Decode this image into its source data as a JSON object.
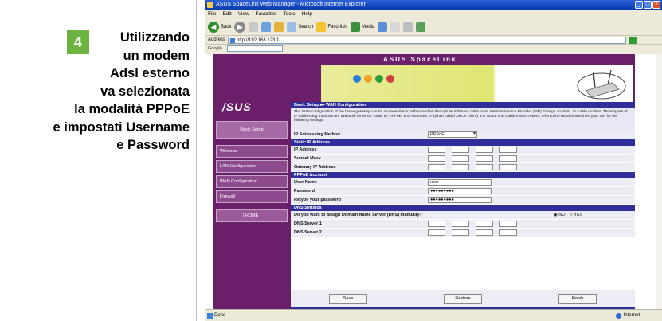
{
  "caption": {
    "step": "4",
    "line1": "Utilizzando",
    "line2": "un modem",
    "line3": "Adsl esterno",
    "line4": "va selezionata",
    "line5": "la modalità PPPoE",
    "line6": "e impostati Username",
    "line7": "e Password",
    "badge_color": "#6db33f"
  },
  "window": {
    "title": "ASUS SpaceLink Web Manager - Microsoft Internet Explorer",
    "menu": [
      "File",
      "Edit",
      "View",
      "Favorites",
      "Tools",
      "Help"
    ],
    "toolbar": {
      "back": "Back",
      "search": "Search",
      "favorites": "Favorites",
      "media": "Media"
    },
    "address_label": "Address",
    "address": "http://192.168.123.1/",
    "google_label": "Google",
    "status": "Done",
    "zone": "Internet"
  },
  "asus": {
    "logo": "/SUS",
    "brand": "ASUS SpaceLink",
    "nav": [
      "Basic Setup",
      "Wireless",
      "LAN Configuration",
      "WAN Configuration",
      "Firewall",
      "[ HOME ]"
    ],
    "section_title": "Basic Setup ▸▸ WAN Configuration",
    "description": "The WAN configuration of the home gateway can be a connection to either modem through an Ethernet cable or an Internet Service Provider (ISP) through an ADSL or Cable modem. Three types of IP addressing methods are available for WAN: Static IP, PPPoE, and Automatic IP (when called DHCP client). For ADSL and Cable modem users, refer to the requirement from your ISP for the following settings.",
    "ip_method_label": "IP Addressing Method",
    "ip_method_value": "PPPoE",
    "static_ip_header": "Static IP Address",
    "ip_address_label": "IP Address",
    "subnet_label": "Subnet Mask",
    "gateway_label": "Gateway IP Address",
    "pppoe_header": "PPPoE Account",
    "username_label": "User Name",
    "username_value": "user",
    "password_label": "Password",
    "password_value": "●●●●●●●●●",
    "retype_label": "Retype your password",
    "retype_value": "●●●●●●●●●",
    "dns_header": "DNS Settings",
    "dns_question": "Do you want to assign Domain Name Server (DNS) manually?",
    "dns_no": "NO",
    "dns_yes": "YES",
    "dns1_label": "DNS Server 1",
    "dns2_label": "DNS Server 2",
    "btn_save": "Save",
    "btn_restore": "Restore",
    "btn_finish": "Finish"
  }
}
